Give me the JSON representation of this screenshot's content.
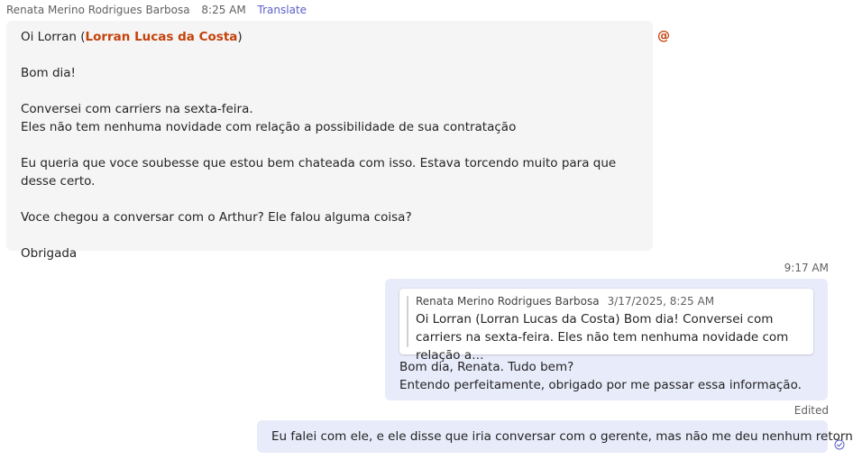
{
  "incoming_message": {
    "sender": "Renata Merino Rodrigues Barbosa",
    "time": "8:25 AM",
    "translate_label": "Translate",
    "greeting_prefix": "Oi Lorran (",
    "mention": "Lorran Lucas da Costa",
    "greeting_suffix": ")",
    "lines": [
      "Bom dia!",
      "Conversei com carriers na sexta-feira.",
      "Eles não tem nenhuma novidade com relação a possibilidade de sua contratação",
      "Eu queria que voce soubesse que estou bem chateada com isso. Estava torcendo muito para que desse certo.",
      "Voce chegou a conversar com o Arthur? Ele falou alguma coisa?",
      "Obrigada"
    ],
    "mention_icon": "@"
  },
  "reply_message": {
    "time": "9:17 AM",
    "quote": {
      "sender": "Renata Merino Rodrigues Barbosa",
      "date": "3/17/2025, 8:25 AM",
      "text": "Oi Lorran (Lorran Lucas da Costa) Bom dia! Conversei com carriers na sexta-feira. Eles não tem nenhuma novidade com relação a…"
    },
    "lines": [
      "Bom dia, Renata. Tudo bem?",
      "Entendo perfeitamente, obrigado por me passar essa informação."
    ]
  },
  "second_reply": {
    "status": "Edited",
    "text": "Eu falei com ele, e ele disse que iria conversar com o gerente, mas não me deu nenhum retorno.",
    "read_icon": "read-check-icon"
  },
  "colors": {
    "mention": "#c4410c",
    "outgoing_bubble": "#e8ebfa",
    "incoming_bubble": "#f5f5f5",
    "accent": "#5b5fc7"
  }
}
